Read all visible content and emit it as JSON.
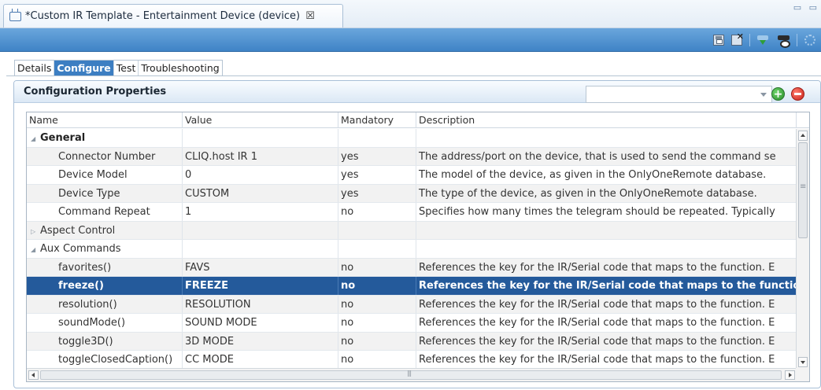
{
  "editor": {
    "tab_title": "*Custom IR Template - Entertainment Device (device)",
    "close_glyph": "☒",
    "window_controls": "▭ ▭"
  },
  "toolbar": {
    "buttons": [
      "save-icon",
      "save-close-icon",
      "download-icon",
      "remote-icon",
      "settings-icon"
    ]
  },
  "subtabs": [
    {
      "label": "Details",
      "active": false
    },
    {
      "label": "Configure",
      "active": true
    },
    {
      "label": "Test",
      "active": false
    },
    {
      "label": "Troubleshooting",
      "active": false
    }
  ],
  "panel": {
    "title": "Configuration Properties",
    "filter_value": ""
  },
  "grid": {
    "columns": [
      "Name",
      "Value",
      "Mandatory",
      "Description"
    ],
    "rows": [
      {
        "type": "group",
        "expanded": true,
        "name": "General",
        "value": "",
        "mandatory": "",
        "description": ""
      },
      {
        "type": "item",
        "name": "Connector Number",
        "value": "CLIQ.host IR 1",
        "mandatory": "yes",
        "description": "The address/port on the device, that is used to send the command se"
      },
      {
        "type": "item",
        "name": "Device Model",
        "value": "0",
        "mandatory": "yes",
        "description": "The model of the device, as given in the OnlyOneRemote database."
      },
      {
        "type": "item",
        "name": "Device Type",
        "value": "CUSTOM",
        "mandatory": "yes",
        "description": "The type of the device, as given in the OnlyOneRemote database."
      },
      {
        "type": "item",
        "name": "Command Repeat",
        "value": "1",
        "mandatory": "no",
        "description": "Specifies how many times the telegram should be repeated. Typically"
      },
      {
        "type": "group2",
        "expanded": false,
        "name": "Aspect Control",
        "value": "",
        "mandatory": "",
        "description": ""
      },
      {
        "type": "group2",
        "expanded": true,
        "name": "Aux Commands",
        "value": "",
        "mandatory": "",
        "description": ""
      },
      {
        "type": "item",
        "name": "favorites()",
        "value": "FAVS",
        "mandatory": "no",
        "description": "References the key for the IR/Serial code that maps to the function. E"
      },
      {
        "type": "item",
        "selected": true,
        "name": "freeze()",
        "value": "FREEZE",
        "mandatory": "no",
        "description": "References the key for the IR/Serial code that maps to the function. E"
      },
      {
        "type": "item",
        "name": "resolution()",
        "value": "RESOLUTION",
        "mandatory": "no",
        "description": "References the key for the IR/Serial code that maps to the function. E"
      },
      {
        "type": "item",
        "name": "soundMode()",
        "value": "SOUND MODE",
        "mandatory": "no",
        "description": "References the key for the IR/Serial code that maps to the function. E"
      },
      {
        "type": "item",
        "name": "toggle3D()",
        "value": "3D MODE",
        "mandatory": "no",
        "description": "References the key for the IR/Serial code that maps to the function. E"
      },
      {
        "type": "item",
        "name": "toggleClosedCaption()",
        "value": "CC MODE",
        "mandatory": "no",
        "description": "References the key for the IR/Serial code that maps to the function. E"
      }
    ]
  },
  "colors": {
    "toolbar": "#3f83c6",
    "selected_row": "#245a9b",
    "active_tab": "#3c7ec2",
    "add_button": "#2c8f2c",
    "remove_button": "#c8231b"
  }
}
